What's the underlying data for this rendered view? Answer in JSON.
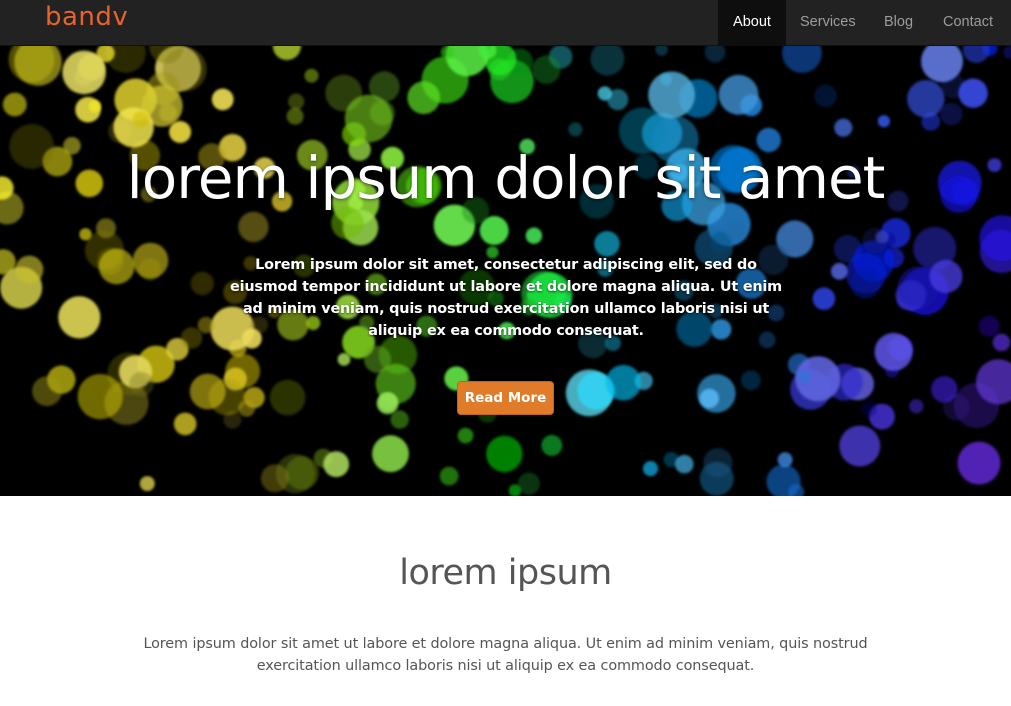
{
  "brand": {
    "name": "bandv",
    "color": "#e8632b"
  },
  "nav": {
    "items": [
      {
        "label": "About",
        "active": true
      },
      {
        "label": "Services",
        "active": false
      },
      {
        "label": "Blog",
        "active": false
      },
      {
        "label": "Contact",
        "active": false
      }
    ]
  },
  "hero": {
    "title": "lorem ipsum dolor sit amet",
    "text": "Lorem ipsum dolor sit amet, consectetur adipiscing elit, sed do eiusmod tempor incididunt ut labore et dolore magna aliqua. Ut enim ad minim veniam, quis nostrud exercitation ullamco laboris nisi ut aliquip ex ea commodo consequat.",
    "button_label": "Read More",
    "button_color": "#e07b2a"
  },
  "section": {
    "title": "lorem ipsum",
    "text": "Lorem ipsum dolor sit amet ut labore et dolore magna aliqua. Ut enim ad minim veniam, quis nostrud exercitation ullamco laboris nisi ut aliquip ex ea commodo consequat."
  },
  "colors": {
    "navbar_bg": "#222222",
    "nav_active_bg": "#0e0e0e",
    "text_muted": "#555555"
  }
}
